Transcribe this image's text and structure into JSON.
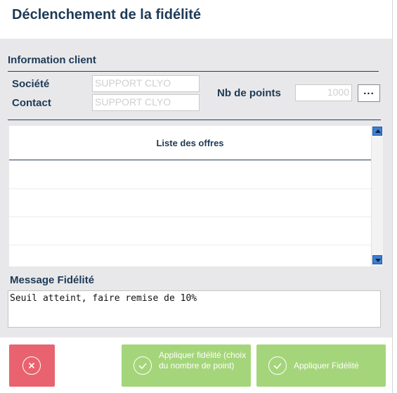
{
  "window": {
    "title": "Déclenchement de la fidélité"
  },
  "client": {
    "section_label": "Information client",
    "societe_label": "Société",
    "societe_value": "SUPPORT CLYO",
    "contact_label": "Contact",
    "contact_value": "SUPPORT CLYO",
    "points_label": "Nb de points",
    "points_value": "1000",
    "more_button_label": "..."
  },
  "offers": {
    "header": "Liste des offres",
    "rows": [
      "",
      "",
      "",
      ""
    ]
  },
  "message": {
    "label": "Message Fidélité",
    "text": "Seuil atteint, faire remise de 10%"
  },
  "buttons": {
    "cancel_icon": "close-circle-icon",
    "apply_choice_label": "Appliquer fidélité (choix du nombre de point)",
    "apply_label": "Appliquer Fidélité",
    "apply_icon": "check-circle-icon"
  },
  "colors": {
    "title": "#1d3a56",
    "cancel": "#e8636f",
    "apply": "#a5d57a",
    "panel": "#e8e8ea",
    "scroll_arrow": "#3c7fd6"
  }
}
